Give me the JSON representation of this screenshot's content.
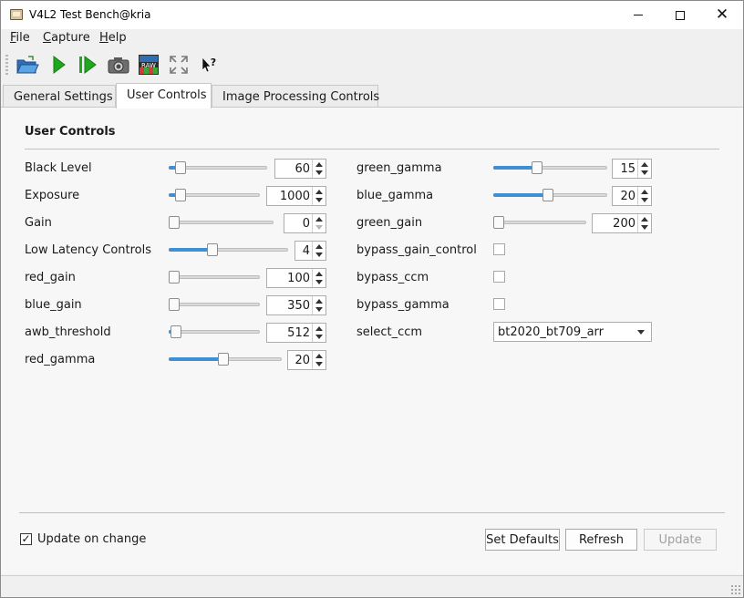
{
  "window": {
    "title": "V4L2 Test Bench@kria"
  },
  "menubar": {
    "file": {
      "underline": "F",
      "rest": "ile"
    },
    "capture": {
      "underline": "C",
      "rest": "apture"
    },
    "help": {
      "underline": "H",
      "rest": "elp"
    }
  },
  "toolbar": {
    "icons": [
      "open-folder-icon",
      "play-icon",
      "step-forward-icon",
      "camera-icon",
      "raw-icon",
      "fullscreen-icon",
      "whats-this-icon"
    ],
    "raw_label": "RAW"
  },
  "tabs": [
    {
      "label": "General Settings",
      "active": false
    },
    {
      "label": "User Controls",
      "active": true
    },
    {
      "label": "Image Processing Controls",
      "active": false
    }
  ],
  "group": {
    "title": "User Controls"
  },
  "left_controls": [
    {
      "label": "Black Level",
      "value": "60",
      "level": 0.07
    },
    {
      "label": "Exposure",
      "value": "1000",
      "level": 0.08
    },
    {
      "label": "Gain",
      "value": "0",
      "level": 0.0
    },
    {
      "label": "Low Latency Controls",
      "value": "4",
      "level": 0.35
    },
    {
      "label": "red_gain",
      "value": "100",
      "level": 0.0
    },
    {
      "label": "blue_gain",
      "value": "350",
      "level": 0.0
    },
    {
      "label": "awb_threshold",
      "value": "512",
      "level": 0.02
    },
    {
      "label": "red_gamma",
      "value": "20",
      "level": 0.48
    }
  ],
  "right_controls": {
    "green_gamma": {
      "label": "green_gamma",
      "value": "15",
      "level": 0.37
    },
    "blue_gamma": {
      "label": "blue_gamma",
      "value": "20",
      "level": 0.48
    },
    "green_gain": {
      "label": "green_gain",
      "value": "200",
      "level": 0.0
    },
    "bypass_gain_control": {
      "label": "bypass_gain_control",
      "checked": false
    },
    "bypass_ccm": {
      "label": "bypass_ccm",
      "checked": false
    },
    "bypass_gamma": {
      "label": "bypass_gamma",
      "checked": false
    },
    "select_ccm": {
      "label": "select_ccm",
      "value": "bt2020_bt709_arr"
    }
  },
  "footer": {
    "update_on_change_label": "Update on change",
    "update_on_change_checked": true,
    "set_defaults_label": "Set Defaults",
    "refresh_label": "Refresh",
    "update_label": "Update"
  },
  "colors": {
    "slider_fill": "#3f8fd4",
    "window_bg": "#f0f0f0"
  }
}
